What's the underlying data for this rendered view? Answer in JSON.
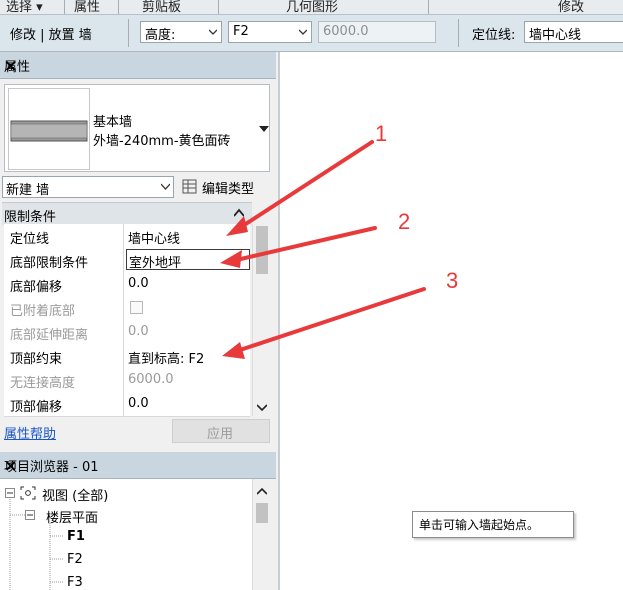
{
  "ribbon_groups": [
    "选择 ▾",
    "属性",
    "剪贴板",
    "几何图形",
    "修改"
  ],
  "options_bar": {
    "context": "修改 | 放置 墙",
    "height_label": "高度:",
    "level_value": "F2",
    "height_value": "6000.0",
    "locline_label": "定位线:",
    "locline_value": "墙中心线"
  },
  "properties": {
    "title": "属性",
    "type_family": "基本墙",
    "type_name": "外墙-240mm-黄色面砖",
    "instance_selector": "新建 墙",
    "edit_type": "编辑类型",
    "section": "限制条件",
    "rows": [
      {
        "label": "定位线",
        "value": "墙中心线",
        "disabled": false
      },
      {
        "label": "底部限制条件",
        "value": "室外地坪",
        "disabled": false
      },
      {
        "label": "底部偏移",
        "value": "0.0",
        "disabled": false
      },
      {
        "label": "已附着底部",
        "value": "",
        "disabled": true
      },
      {
        "label": "底部延伸距离",
        "value": "0.0",
        "disabled": true
      },
      {
        "label": "顶部约束",
        "value": "直到标高: F2",
        "disabled": false
      },
      {
        "label": "无连接高度",
        "value": "6000.0",
        "disabled": true
      },
      {
        "label": "顶部偏移",
        "value": "0.0",
        "disabled": false
      }
    ],
    "help_link": "属性帮助",
    "apply": "应用"
  },
  "browser": {
    "title": "项目浏览器 - 01",
    "views": "视图 (全部)",
    "floor_plans": "楼层平面",
    "levels": [
      "F1",
      "F2",
      "F3"
    ]
  },
  "canvas": {
    "tooltip": "单击可输入墙起始点。"
  },
  "annotations": [
    "1",
    "2",
    "3"
  ],
  "colors": {
    "annotation": "#e83a3a",
    "panel_header": "#c9d6df",
    "options_bar": "#dbe6ec"
  }
}
